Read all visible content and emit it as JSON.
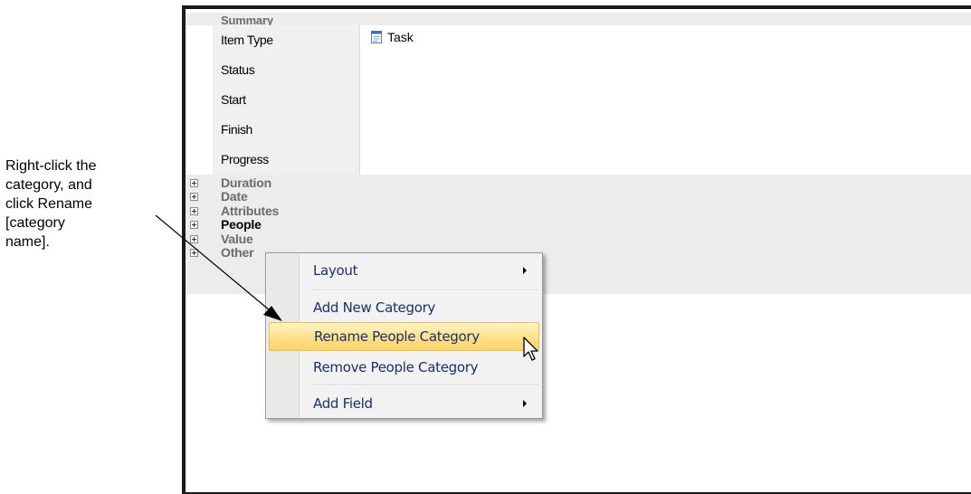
{
  "callout": {
    "lines": [
      "Right-click the",
      "category, and",
      "click Rename",
      "[category",
      "name]."
    ]
  },
  "grid": {
    "summary_label": "Summary",
    "properties": [
      {
        "label": "Item Type",
        "value": "Task",
        "icon": "task-document-icon"
      },
      {
        "label": "Status",
        "value": ""
      },
      {
        "label": "Start",
        "value": ""
      },
      {
        "label": "Finish",
        "value": ""
      },
      {
        "label": "Progress",
        "value": ""
      }
    ],
    "categories": [
      "Duration",
      "Date",
      "Attributes",
      "People",
      "Value",
      "Other"
    ]
  },
  "context_menu": {
    "items": [
      {
        "label": "Layout",
        "submenu": true
      },
      {
        "label": "Add New Category",
        "submenu": false
      },
      {
        "label": "Rename People Category",
        "submenu": false,
        "highlighted": true
      },
      {
        "label": "Remove People Category",
        "submenu": false
      },
      {
        "label": "Add Field",
        "submenu": true
      }
    ]
  },
  "colors": {
    "menu_highlight": "#fde08a",
    "menu_text": "#1a2f6c",
    "category_bg": "#ececec",
    "label_bg": "#f0f0f0"
  }
}
